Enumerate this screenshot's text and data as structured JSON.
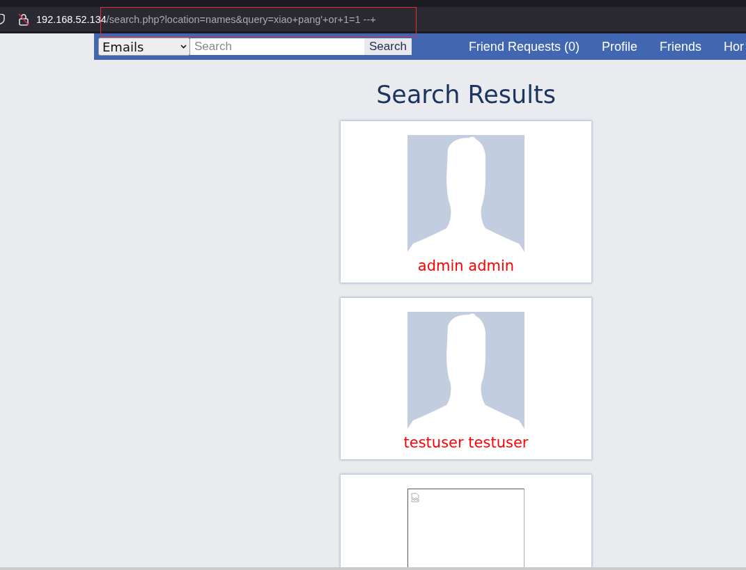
{
  "address_bar": {
    "host": "192.168.52.134",
    "path": "/search.php?location=names&query=xiao+pang'+or+1=1 --+",
    "highlighted": true
  },
  "navbar": {
    "filter": "Emails",
    "search_placeholder": "Search",
    "search_button": "Search",
    "links": [
      "Friend Requests (0)",
      "Profile",
      "Friends",
      "Hor"
    ]
  },
  "title": "Search Results",
  "results": [
    {
      "kind": "avatar",
      "name": "admin admin"
    },
    {
      "kind": "avatar",
      "name": "testuser testuser"
    },
    {
      "kind": "broken-image"
    }
  ]
}
